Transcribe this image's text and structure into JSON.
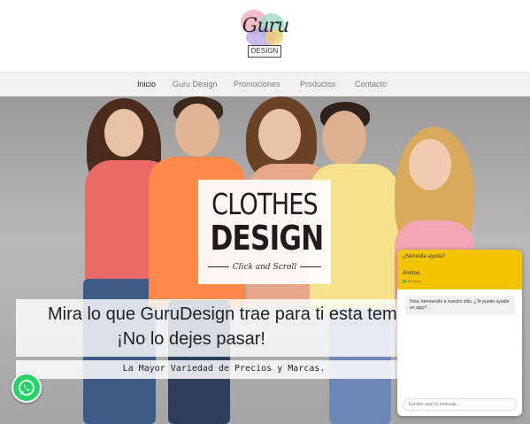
{
  "logo": {
    "text": "Guru",
    "sub": "DESIGN"
  },
  "nav": {
    "items": [
      {
        "label": "Inicio",
        "active": true
      },
      {
        "label": "Guru Design",
        "active": false
      },
      {
        "label": "Promociones",
        "active": false
      },
      {
        "label": "Productos",
        "active": false
      },
      {
        "label": "Contacto",
        "active": false
      }
    ]
  },
  "hero": {
    "title_line1": "CLOTHES",
    "title_line2": "DESIGN",
    "subtitle": "Click and Scroll",
    "banner_line1": "Mira lo que GuruDesign trae para ti esta temporada.",
    "banner_line2": "¡No lo dejes pasar!",
    "tagline": "La Mayor Variedad de Precios y Marcas."
  },
  "chat": {
    "header_title": "¿Necesita ayuda?",
    "agent_name": "Andrea",
    "agent_status": "En línea",
    "message": "Hola, bienvenido a nuestro sitio, ¿Te puedo ayudar en algo?",
    "input_placeholder": "Escribe aquí tu mensaje...",
    "accent_color": "#f5c400"
  },
  "whatsapp": {
    "icon": "whatsapp-icon",
    "color": "#25d366"
  }
}
